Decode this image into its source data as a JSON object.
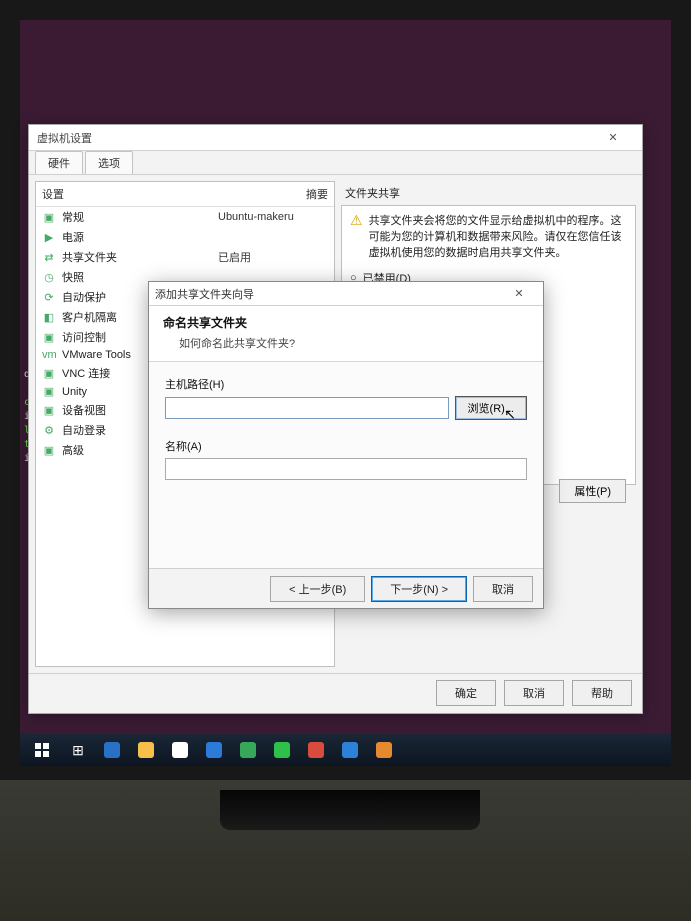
{
  "vm_settings": {
    "title": "虚拟机设置",
    "tabs": {
      "hardware": "硬件",
      "options": "选项"
    },
    "device_head": {
      "device": "设置",
      "summary": "摘要"
    },
    "devices": [
      {
        "icon": "▣",
        "name": "常规",
        "summary": "Ubuntu-makeru"
      },
      {
        "icon": "▶",
        "name": "电源",
        "summary": ""
      },
      {
        "icon": "⇄",
        "name": "共享文件夹",
        "summary": "已启用"
      },
      {
        "icon": "◷",
        "name": "快照",
        "summary": ""
      },
      {
        "icon": "⟳",
        "name": "自动保护",
        "summary": ""
      },
      {
        "icon": "◧",
        "name": "客户机隔离",
        "summary": ""
      },
      {
        "icon": "▣",
        "name": "访问控制",
        "summary": ""
      },
      {
        "icon": "vm",
        "name": "VMware Tools",
        "summary": ""
      },
      {
        "icon": "▣",
        "name": "VNC 连接",
        "summary": ""
      },
      {
        "icon": "▣",
        "name": "Unity",
        "summary": ""
      },
      {
        "icon": "▣",
        "name": "设备视图",
        "summary": ""
      },
      {
        "icon": "⚙",
        "name": "自动登录",
        "summary": ""
      },
      {
        "icon": "▣",
        "name": "高级",
        "summary": ""
      }
    ],
    "right": {
      "section": "文件夹共享",
      "warn_text": "共享文件夹会将您的文件显示给虚拟机中的程序。这可能为您的计算机和数据带来风险。请仅在您信任该虚拟机使用您的数据时启用共享文件夹。",
      "radio_disabled": "已禁用(D)",
      "properties_btn": "属性(P)"
    },
    "buttons": {
      "ok": "确定",
      "cancel": "取消",
      "help": "帮助"
    }
  },
  "wizard": {
    "title": "添加共享文件夹向导",
    "heading": "命名共享文件夹",
    "subheading": "如何命名此共享文件夹?",
    "host_path_label": "主机路径(H)",
    "host_path_value": "",
    "browse_label": "浏览(R)...",
    "name_label": "名称(A)",
    "name_value": "",
    "back": "< 上一步(B)",
    "next": "下一步(N) >",
    "cancel": "取消"
  },
  "terminal": {
    "lines": [
      "",
      "d lin",
      " such",
      "cd lin",
      "inuxsh",
      "l.c  s",
      "test f",
      "inuxsh"
    ]
  },
  "taskbar": {
    "icons": [
      "start",
      "taskview",
      "edge",
      "folder",
      "store",
      "settings",
      "chrome",
      "wechat",
      "app1",
      "app2",
      "app3"
    ]
  }
}
